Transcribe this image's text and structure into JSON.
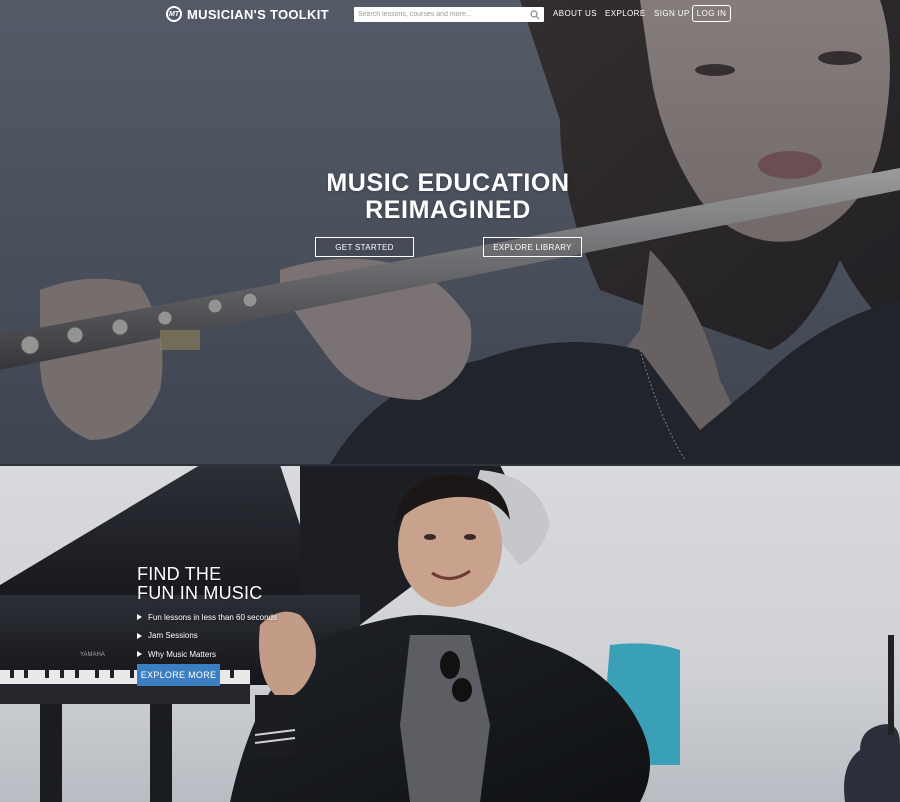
{
  "nav": {
    "brand": "MUSICIAN'S TOOLKIT",
    "brand_mark": "MT",
    "search_placeholder": "Search lessons, courses and more...",
    "search_value": "",
    "links": [
      "ABOUT US",
      "EXPLORE",
      "SIGN UP"
    ],
    "login": "LOG IN"
  },
  "hero": {
    "title_line1": "MUSIC EDUCATION",
    "title_line2": "REIMAGINED",
    "get_started": "GET STARTED",
    "explore_library": "EXPLORE LIBRARY"
  },
  "feature": {
    "title_line1": "FIND THE",
    "title_line2": "FUN IN MUSIC",
    "items": [
      "Fun lessons in less than 60 seconds",
      "Jam Sessions",
      "Why Music Matters"
    ],
    "cta": "EXPLORE MORE",
    "piano_brand": "YAMAHA"
  },
  "colors": {
    "cta_blue": "#3a7fc1",
    "hero_overlay": "#4b525e",
    "nav_text": "#ffffff"
  },
  "icons": {
    "search": "search-icon",
    "list_bullet": "triangle-right-icon"
  }
}
